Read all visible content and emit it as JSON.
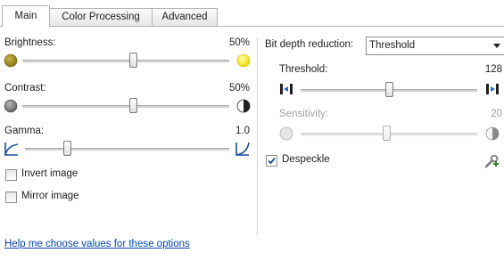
{
  "tabs": [
    {
      "label": "Main",
      "active": true
    },
    {
      "label": "Color Processing",
      "active": false
    },
    {
      "label": "Advanced",
      "active": false
    }
  ],
  "left": {
    "brightness": {
      "label": "Brightness:",
      "value": "50%",
      "level": 0.5
    },
    "contrast": {
      "label": "Contrast:",
      "value": "50%",
      "level": 0.5
    },
    "gamma": {
      "label": "Gamma:",
      "value": "1.0",
      "level": 0.12
    },
    "invert": {
      "label": "Invert image",
      "checked": false
    },
    "mirror": {
      "label": "Mirror image",
      "checked": false
    }
  },
  "right": {
    "bitdepth": {
      "label": "Bit depth reduction:",
      "selected": "Threshold"
    },
    "threshold": {
      "label": "Threshold:",
      "value": "128",
      "level": 0.5
    },
    "sensitivity": {
      "label": "Sensitivity:",
      "value": "20",
      "level": 0.5,
      "enabled": false
    },
    "despeckle": {
      "label": "Despeckle",
      "checked": true
    }
  },
  "help_link": "Help me choose values for these options",
  "icons": {
    "brightness_low": "dim-sun-icon",
    "brightness_high": "bright-sun-icon",
    "contrast_low": "low-contrast-icon",
    "contrast_high": "high-contrast-icon",
    "gamma_low": "gamma-low-curve-icon",
    "gamma_high": "gamma-high-curve-icon",
    "threshold_low": "threshold-low-icon",
    "threshold_high": "threshold-high-icon",
    "sensitivity_low": "sensitivity-low-icon",
    "sensitivity_high": "sensitivity-high-icon",
    "despeckle_settings": "wrench-settings-icon"
  },
  "colors": {
    "link": "#0645ad",
    "accent_check": "#1c4f8f",
    "disabled_text": "#a0a0a0"
  }
}
